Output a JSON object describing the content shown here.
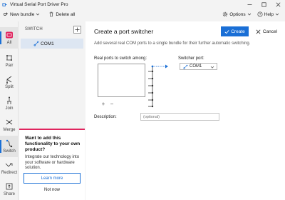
{
  "window": {
    "title": "Virtual Serial Port Driver Pro"
  },
  "menubar": {
    "new_bundle": "New bundle",
    "delete_all": "Delete all",
    "options": "Options",
    "help": "Help"
  },
  "nav": [
    {
      "label": "All",
      "icon": "all-ports-icon"
    },
    {
      "label": "Pair",
      "icon": "pair-icon"
    },
    {
      "label": "Split",
      "icon": "split-icon"
    },
    {
      "label": "Join",
      "icon": "join-icon"
    },
    {
      "label": "Merge",
      "icon": "merge-icon"
    },
    {
      "label": "Switch",
      "icon": "switch-icon"
    },
    {
      "label": "Redirect",
      "icon": "redirect-icon"
    },
    {
      "label": "Share",
      "icon": "share-icon"
    }
  ],
  "list": {
    "header": "SWITCH",
    "items": [
      {
        "label": "COM1"
      }
    ]
  },
  "promo": {
    "title": "Want to add this functionality to your own product?",
    "body": "Integrate our technology into your software or hardware solution.",
    "learn_more": "Learn more",
    "not_now": "Not now"
  },
  "main": {
    "title": "Create a port switcher",
    "create": "Create",
    "cancel": "Cancel",
    "subtitle": "Add several real COM ports to a single bundle for their further automatic switching.",
    "real_ports_label": "Real ports to switch among:",
    "switcher_port_label": "Switcher port:",
    "switcher_port_value": "COM1",
    "add_symbol": "+",
    "remove_symbol": "−",
    "description_label": "Description:",
    "description_placeholder": "(optional)"
  },
  "colors": {
    "accent": "#1a6fd6",
    "promo_border": "#e0245e"
  }
}
